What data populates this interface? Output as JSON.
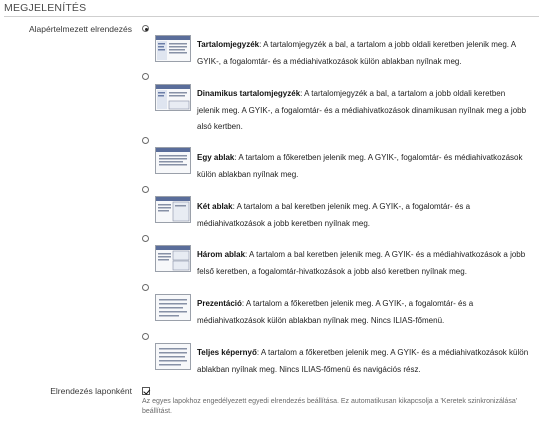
{
  "section": {
    "title": "MEGJELENÍTÉS"
  },
  "fields": {
    "default_layout_label": "Alapértelmezett elrendezés",
    "per_page_layout_label": "Elrendezés laponként",
    "per_page_info": "Az egyes lapokhoz engedélyezett egyedi elrendezés beállítása. Ez automatikusan kikapcsolja a 'Keretek szinkronizálása' beállítást."
  },
  "layouts": [
    {
      "name": "Tartalomjegyzék",
      "text": ": A tartalomjegyzék a bal, a tartalom a jobb oldali keretben jelenik meg. A GYIK-, a fogalomtár- és a médiahivatkozások külön ablakban nyílnak meg.",
      "selected": true
    },
    {
      "name": "Dinamikus tartalomjegyzék",
      "text": ": A tartalomjegyzék a bal, a tartalom a jobb oldali keretben jelenik meg. A GYIK-, a fogalomtár- és a médiahivatkozások dinamikusan nyílnak meg a jobb alsó kertben.",
      "selected": false
    },
    {
      "name": "Egy ablak",
      "text": ": A tartalom a főkeretben jelenik meg. A GYIK-, fogalomtár- és médiahivatkozások külön ablakban nyílnak meg.",
      "selected": false
    },
    {
      "name": "Két ablak",
      "text": ": A tartalom a bal keretben jelenik meg. A GYIK-, a fogalomtár- és a médiahivatkozások a jobb keretben nyílnak meg.",
      "selected": false
    },
    {
      "name": "Három ablak",
      "text": ": A tartalom a bal keretben jelenik meg. A GYIK- és a médiahivatkozások a jobb felső keretben, a fogalomtár-hivatkozások a jobb alsó keretben nyílnak meg.",
      "selected": false
    },
    {
      "name": "Prezentáció",
      "text": ": A tartalom a főkeretben jelenik meg. A GYIK-, a fogalomtár- és a médiahivatkozások külön ablakban nyílnak meg. Nincs ILIAS-főmenü.",
      "selected": false
    },
    {
      "name": "Teljes képernyő",
      "text": ": A tartalom a főkeretben jelenik meg. A GYIK- és a médiahivatkozások külön ablakban nyílnak meg. Nincs ILIAS-főmenü és navigációs rész.",
      "selected": false
    }
  ],
  "per_page_layout_checked": true
}
